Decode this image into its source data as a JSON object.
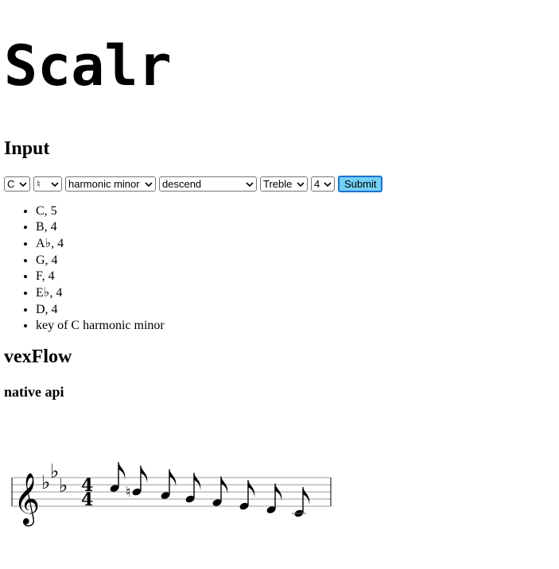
{
  "app": {
    "title": "Scalr"
  },
  "input_section": {
    "heading": "Input",
    "controls": {
      "note": "C",
      "accidental": "♮",
      "scale": "harmonic minor",
      "direction": "descend",
      "clef": "Treble",
      "octave": "4",
      "submit_label": "Submit"
    }
  },
  "notes": [
    "C, 5",
    "B, 4",
    "A♭, 4",
    "G, 4",
    "F, 4",
    "E♭, 4",
    "D, 4",
    "key of C harmonic minor"
  ],
  "vexflow_section": {
    "heading": "vexFlow",
    "subheading": "native api",
    "staff": {
      "clef": "treble",
      "key_signature_flats": 3,
      "time_signature": [
        "4",
        "4"
      ],
      "notes_sequence": [
        "C5",
        "B4 natural",
        "A♭4",
        "G4",
        "F4",
        "E♭4",
        "D4",
        "C4"
      ],
      "note_duration": "eighth"
    }
  }
}
